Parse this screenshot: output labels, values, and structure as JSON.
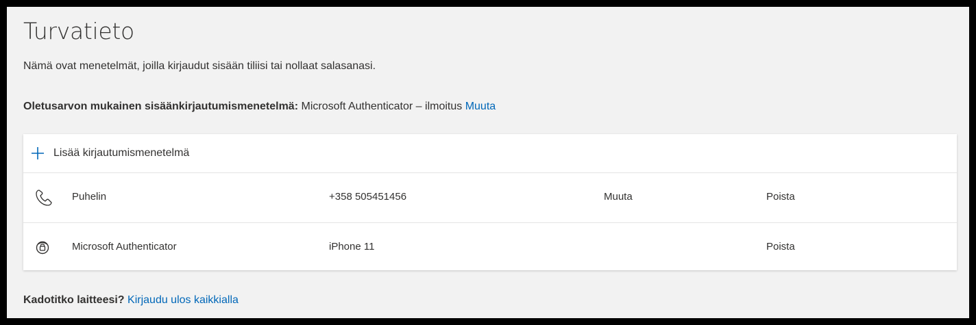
{
  "page": {
    "title": "Turvatieto",
    "subtitle": "Nämä ovat menetelmät, joilla kirjaudut sisään tiliisi tai nollaat salasanasi."
  },
  "default_method": {
    "label": "Oletusarvon mukainen sisäänkirjautumismenetelmä:",
    "value": "Microsoft Authenticator – ilmoitus",
    "change_link": "Muuta"
  },
  "card": {
    "add_method_label": "Lisää kirjautumismenetelmä",
    "add_icon": "plus-icon",
    "methods": [
      {
        "icon": "phone-icon",
        "name": "Puhelin",
        "detail": "+358 505451456",
        "change_link": "Muuta",
        "delete_link": "Poista"
      },
      {
        "icon": "authenticator-lock-icon",
        "name": "Microsoft Authenticator",
        "detail": "iPhone 11",
        "change_link": "",
        "delete_link": "Poista"
      }
    ]
  },
  "lost_device": {
    "question": "Kadotitko laitteesi?",
    "link": "Kirjaudu ulos kaikkialla"
  },
  "colors": {
    "link": "#0067b8",
    "background": "#f2f2f2",
    "card": "#ffffff",
    "text": "#323130"
  }
}
